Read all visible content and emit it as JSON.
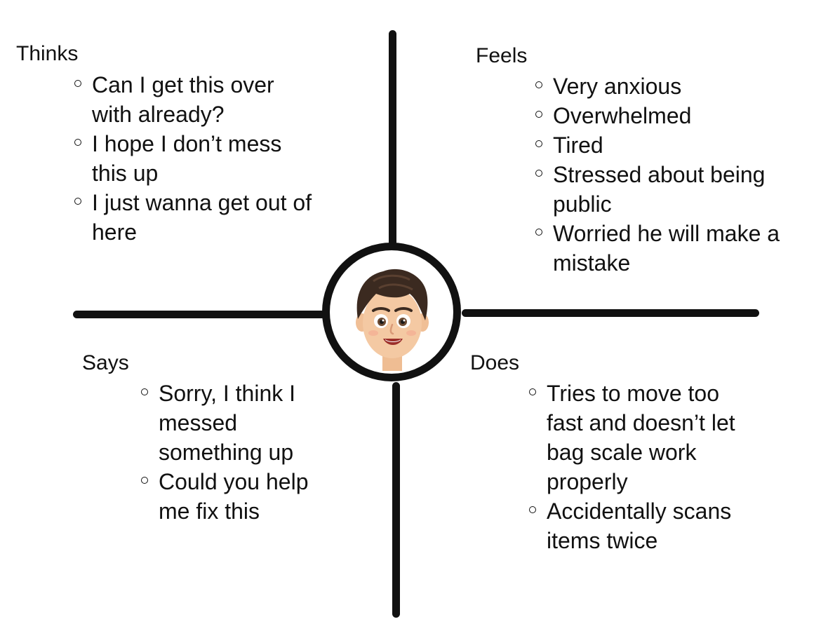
{
  "quadrants": {
    "thinks": {
      "heading": "Thinks",
      "items": [
        "Can I get this over with already?",
        "I hope I don’t mess this up",
        "I just wanna get out of here"
      ]
    },
    "feels": {
      "heading": "Feels",
      "items": [
        "Very anxious",
        "Overwhelmed",
        "Tired",
        "Stressed about being public",
        "Worried he will make a mistake"
      ]
    },
    "says": {
      "heading": "Says",
      "items": [
        "Sorry, I think I messed something up",
        "Could you help me fix this"
      ]
    },
    "does": {
      "heading": "Does",
      "items": [
        "Tries to move too fast and doesn’t let bag scale work properly",
        "Accidentally scans items twice"
      ]
    }
  },
  "center": {
    "icon": "cartoon-boy-avatar-icon"
  },
  "colors": {
    "lines": "#111111",
    "background": "#ffffff",
    "hair": "#3b2a20",
    "skin": "#f4c9a3"
  }
}
